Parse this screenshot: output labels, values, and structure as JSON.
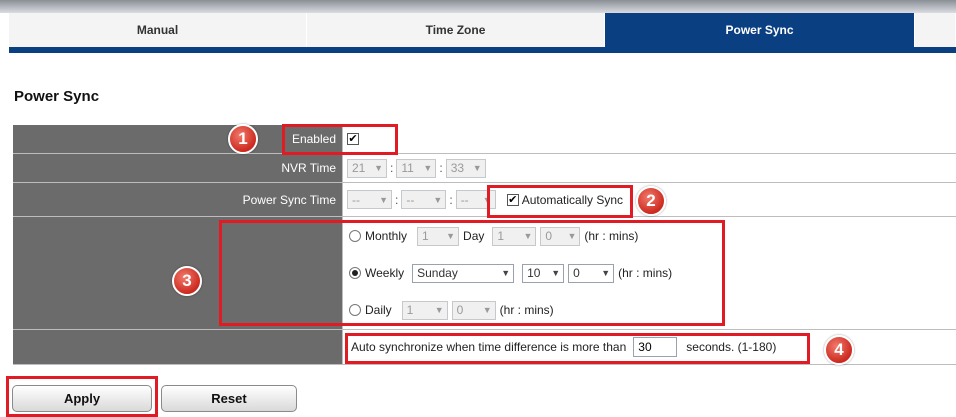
{
  "tabs": [
    "Manual",
    "Time Zone",
    "Power Sync",
    ""
  ],
  "active_tab": "Power Sync",
  "section_title": "Power Sync",
  "rows": {
    "enabled": {
      "label": "Enabled",
      "checked": true
    },
    "nvr_time": {
      "label": "NVR Time",
      "hour": "21",
      "minute": "11",
      "second": "33"
    },
    "power_sync_time": {
      "label": "Power Sync Time",
      "hour": "--",
      "minute": "--",
      "second": "--",
      "auto_sync_label": "Automatically Sync",
      "auto_sync_checked": true
    }
  },
  "schedule": {
    "monthly": {
      "label": "Monthly",
      "day_value": "1",
      "day_label": "Day",
      "hour": "1",
      "minute": "0",
      "unit": "(hr : mins)",
      "selected": false
    },
    "weekly": {
      "label": "Weekly",
      "weekday": "Sunday",
      "hour": "10",
      "minute": "0",
      "unit": "(hr : mins)",
      "selected": true
    },
    "daily": {
      "label": "Daily",
      "hour": "1",
      "minute": "0",
      "unit": "(hr : mins)",
      "selected": false
    }
  },
  "threshold": {
    "prefix": "Auto synchronize when time difference is more than",
    "value": "30",
    "suffix": "seconds. (1-180)"
  },
  "buttons": {
    "apply": "Apply",
    "reset": "Reset"
  },
  "badges": [
    "1",
    "2",
    "3",
    "4"
  ],
  "icons": {
    "dropdown": "chevron-down-icon",
    "check": "checkmark-icon"
  },
  "colors": {
    "tab_active": "#0a3f82",
    "label_bg": "#6b6b6b",
    "highlight": "#e01b24",
    "badge": "#cc2a20"
  }
}
